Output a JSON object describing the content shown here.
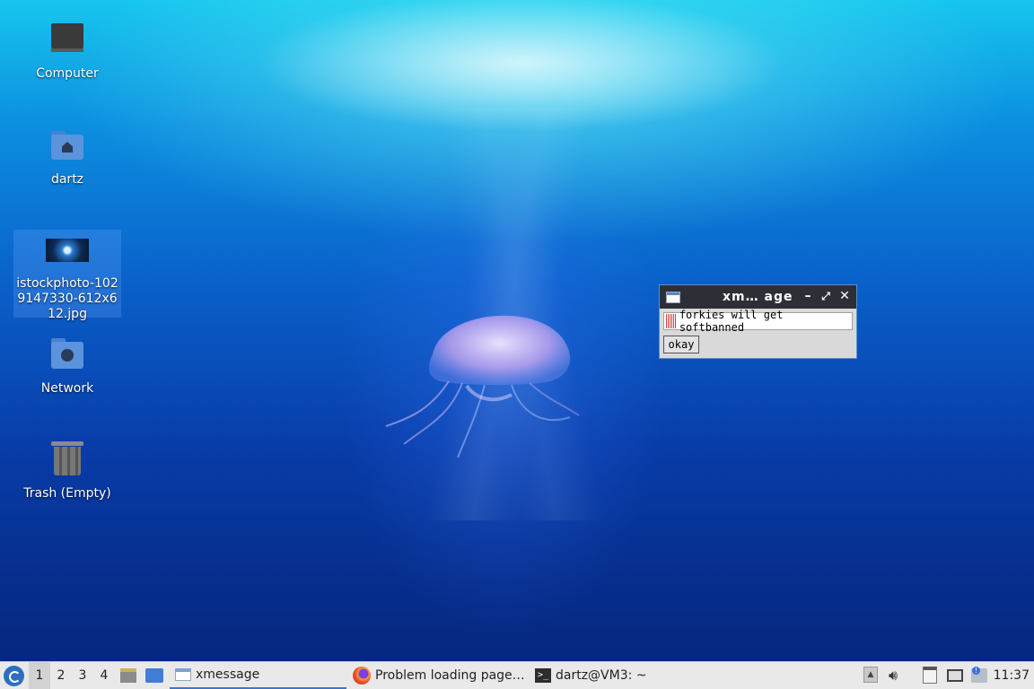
{
  "desktop": {
    "icons": [
      {
        "label": "Computer"
      },
      {
        "label": "dartz"
      },
      {
        "label": "istockphoto-1029147330-612x612.jpg"
      },
      {
        "label": "Network"
      },
      {
        "label": "Trash (Empty)"
      }
    ]
  },
  "xmessage_window": {
    "title": "xm… age",
    "message": "forkies will get softbanned",
    "button_label": "okay",
    "minimize_glyph": "–",
    "maximize_glyph": "⤢",
    "close_glyph": "✕"
  },
  "taskbar": {
    "workspaces": [
      "1",
      "2",
      "3",
      "4"
    ],
    "active_workspace": "1",
    "tasks": [
      {
        "label": "xmessage",
        "icon": "window-icon",
        "active": true
      },
      {
        "label": "Problem loading page…",
        "icon": "firefox-icon",
        "active": false
      },
      {
        "label": "dartz@VM3: ~",
        "icon": "terminal-icon",
        "active": false
      }
    ],
    "clock": "11:37"
  },
  "colors": {
    "taskbar_bg": "#e9e9e9",
    "accent": "#3a78d0",
    "titlebar": "#2c3036"
  }
}
